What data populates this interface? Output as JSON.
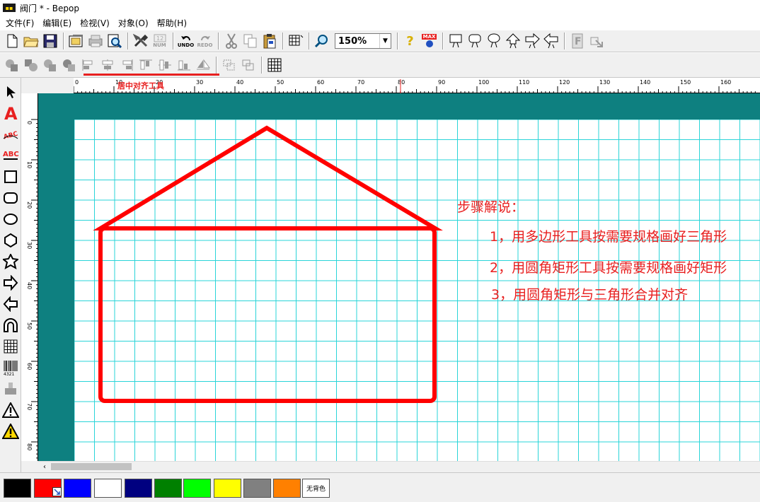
{
  "window": {
    "title": "阀门 * - Bepop",
    "icon_label": "Bepop"
  },
  "menu": [
    "文件(F)",
    "编辑(E)",
    "检视(V)",
    "对象(O)",
    "帮助(H)"
  ],
  "toolbar1": {
    "undo_label": "UNDO",
    "redo_label": "REDO",
    "num_label": "NUM",
    "max_label": "MAX",
    "zoom_value": "150%",
    "help_glyph": "?"
  },
  "toolbar2": {
    "annotation": "居中对齐工具"
  },
  "ruler_top": [
    "0",
    "10",
    "20",
    "30",
    "40",
    "50",
    "60",
    "70",
    "80",
    "90",
    "100",
    "110",
    "120",
    "130",
    "140",
    "150",
    "160",
    "170"
  ],
  "ruler_left": [
    "0",
    "10",
    "20",
    "30",
    "40",
    "50",
    "60",
    "70",
    "80"
  ],
  "steps": {
    "heading": "步骤解说：",
    "items": [
      "1，用多边形工具按需要规格画好三角形",
      "2，用圆角矩形工具按需要规格画好矩形",
      "3，用圆角矩形与三角形合并对齐"
    ]
  },
  "drawing": {
    "stroke_color": "#ff0000",
    "shapes": [
      "triangle",
      "rounded-rectangle"
    ]
  },
  "palette": {
    "colors": [
      "#000000",
      "#ff0000",
      "#0000ff",
      "#ffffff",
      "#000080",
      "#008000",
      "#00ff00",
      "#ffff00",
      "#808080",
      "#ff8000"
    ],
    "selected_index": 1,
    "no_fill_label": "无背色"
  },
  "colors": {
    "canvas_bg": "#0e8080",
    "grid": "#29d4d8",
    "accent": "#e82020"
  }
}
